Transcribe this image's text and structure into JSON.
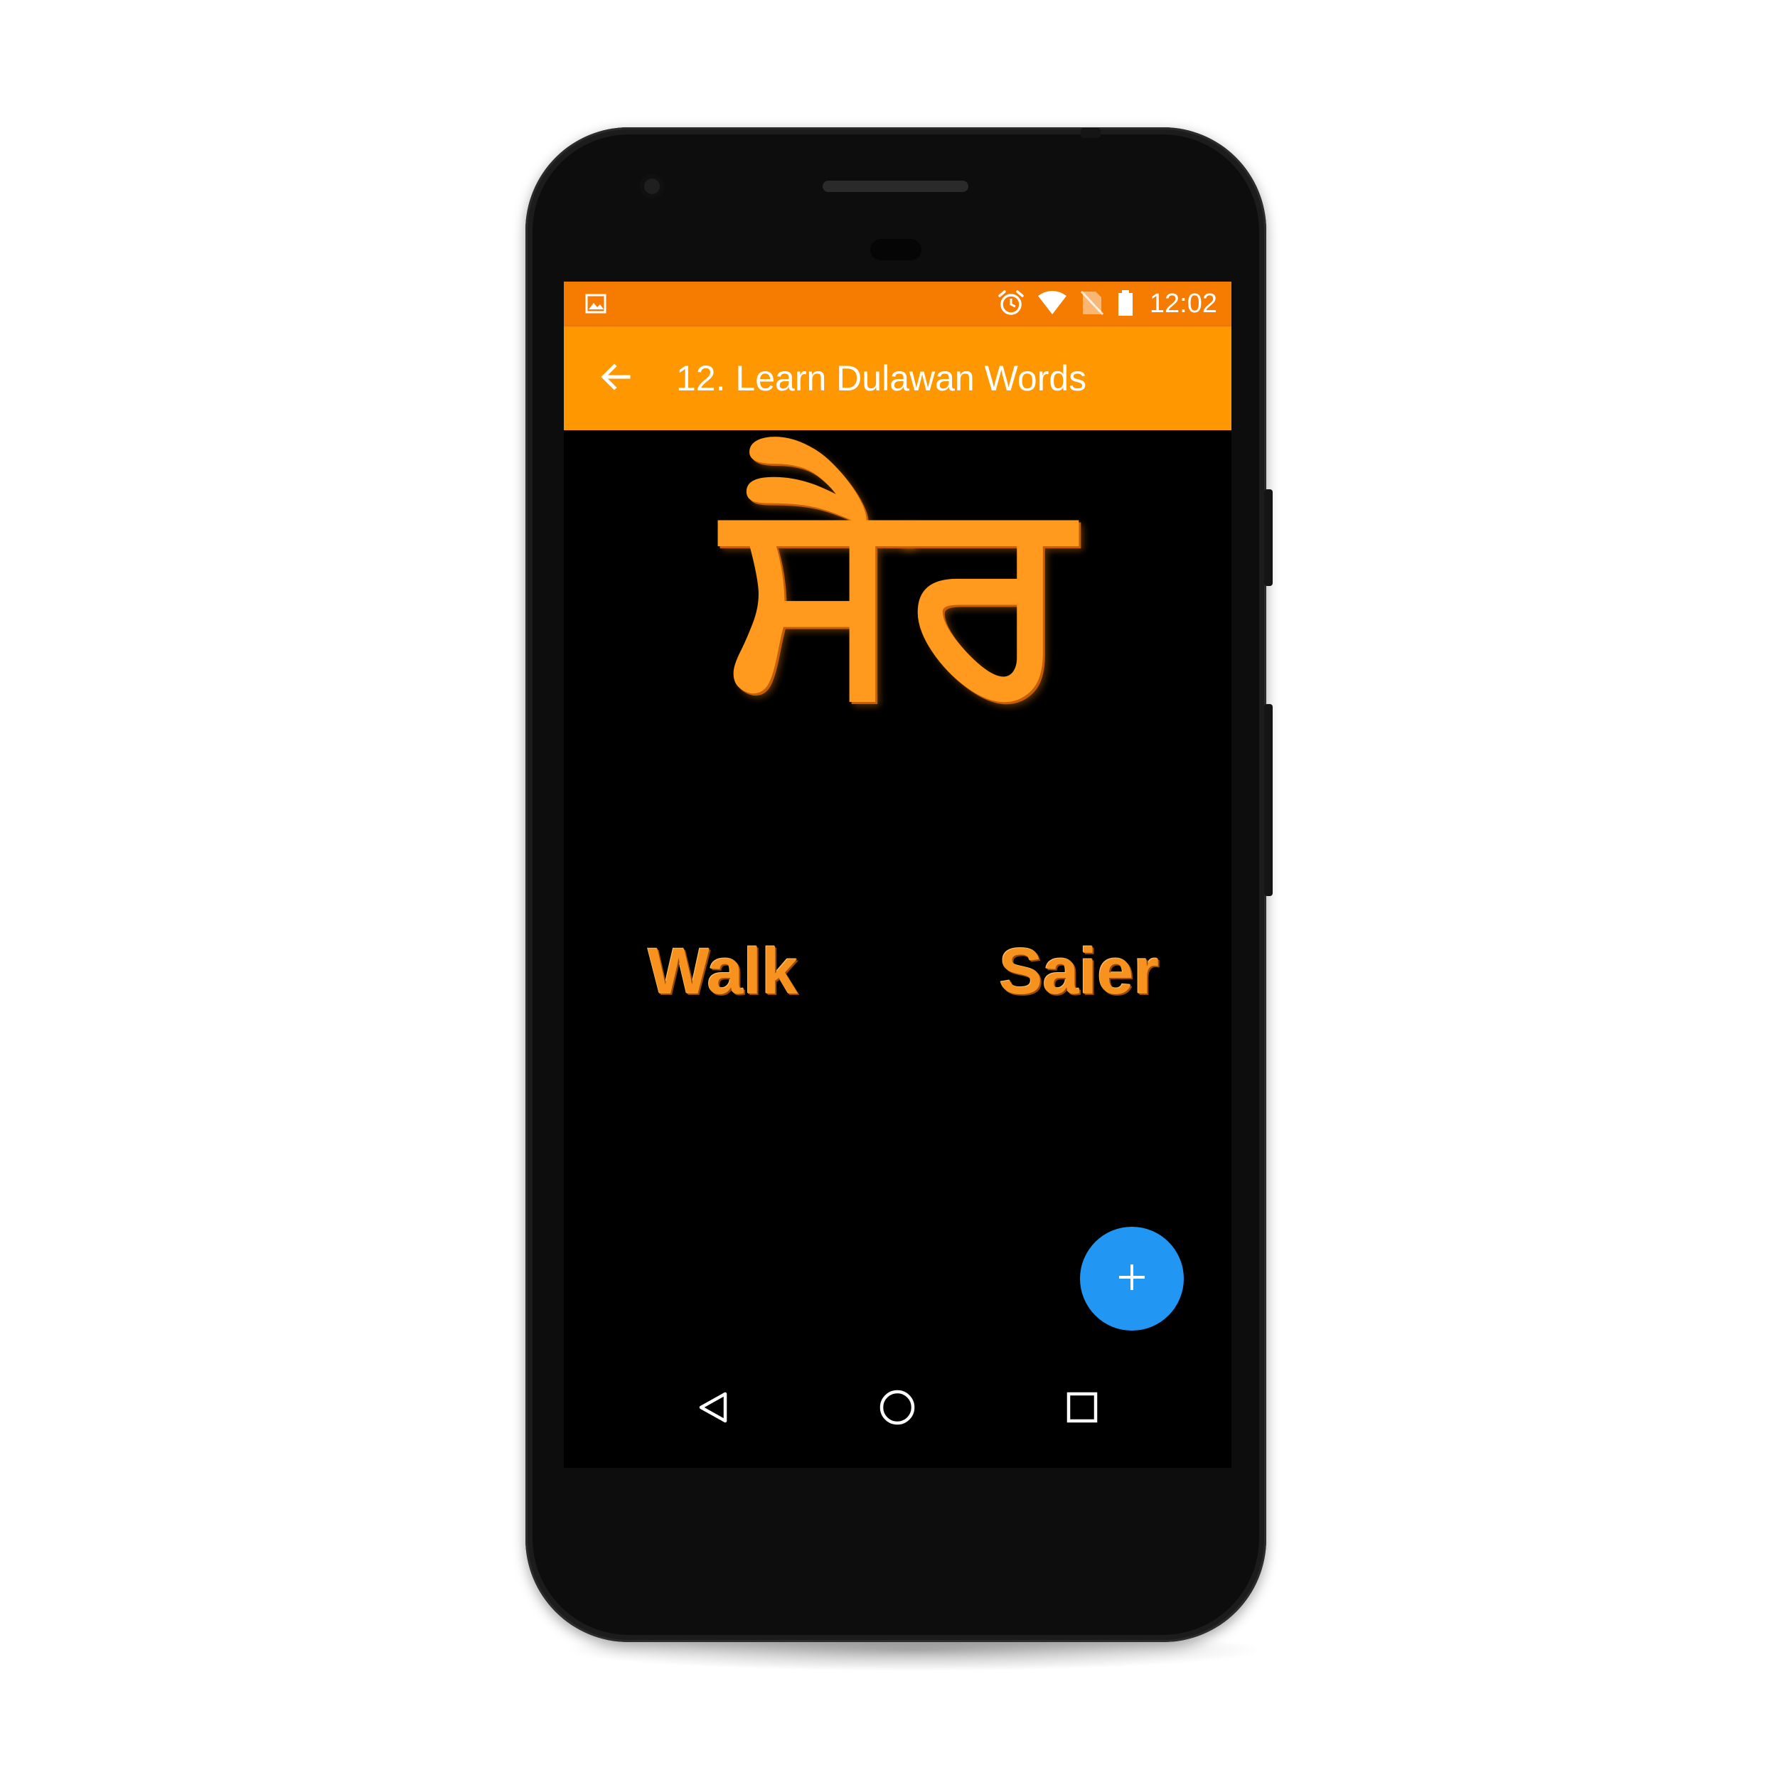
{
  "status_bar": {
    "time": "12:02",
    "icons": [
      "image-notification-icon",
      "alarm-icon",
      "wifi-icon",
      "no-sim-icon",
      "battery-icon"
    ]
  },
  "app_bar": {
    "title": "12. Learn Dulawan Words",
    "back_icon": "arrow-back-icon"
  },
  "lesson": {
    "gurmukhi_word": "ਸੈਰ",
    "english_meaning": "Walk",
    "pronunciation": "Saier"
  },
  "fab": {
    "icon": "plus-icon"
  },
  "nav_bar": {
    "icons": [
      "nav-back-icon",
      "nav-home-icon",
      "nav-recents-icon"
    ]
  },
  "colors": {
    "status_bar": "#f57c00",
    "app_bar": "#ff9800",
    "accent_text": "#f7921e",
    "fab": "#2196f3",
    "background": "#000000"
  }
}
